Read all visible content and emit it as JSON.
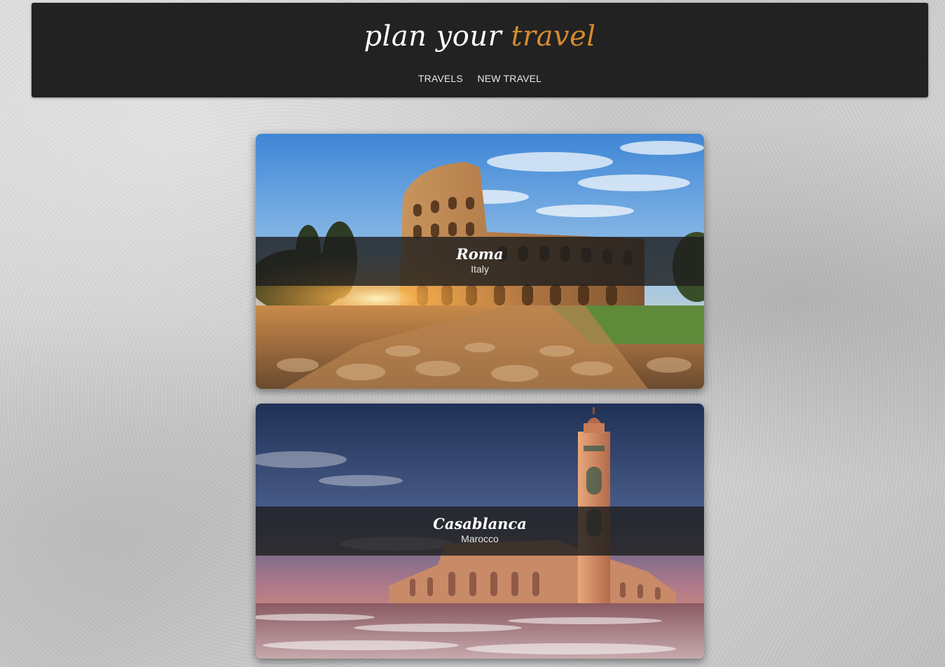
{
  "header": {
    "brand_prefix": "plan your ",
    "brand_accent": "travel",
    "accent_color": "#d68a2e",
    "nav": [
      {
        "label": "TRAVELS"
      },
      {
        "label": "NEW TRAVEL"
      }
    ]
  },
  "travels": [
    {
      "city": "Roma",
      "country": "Italy"
    },
    {
      "city": "Casablanca",
      "country": "Marocco"
    }
  ]
}
